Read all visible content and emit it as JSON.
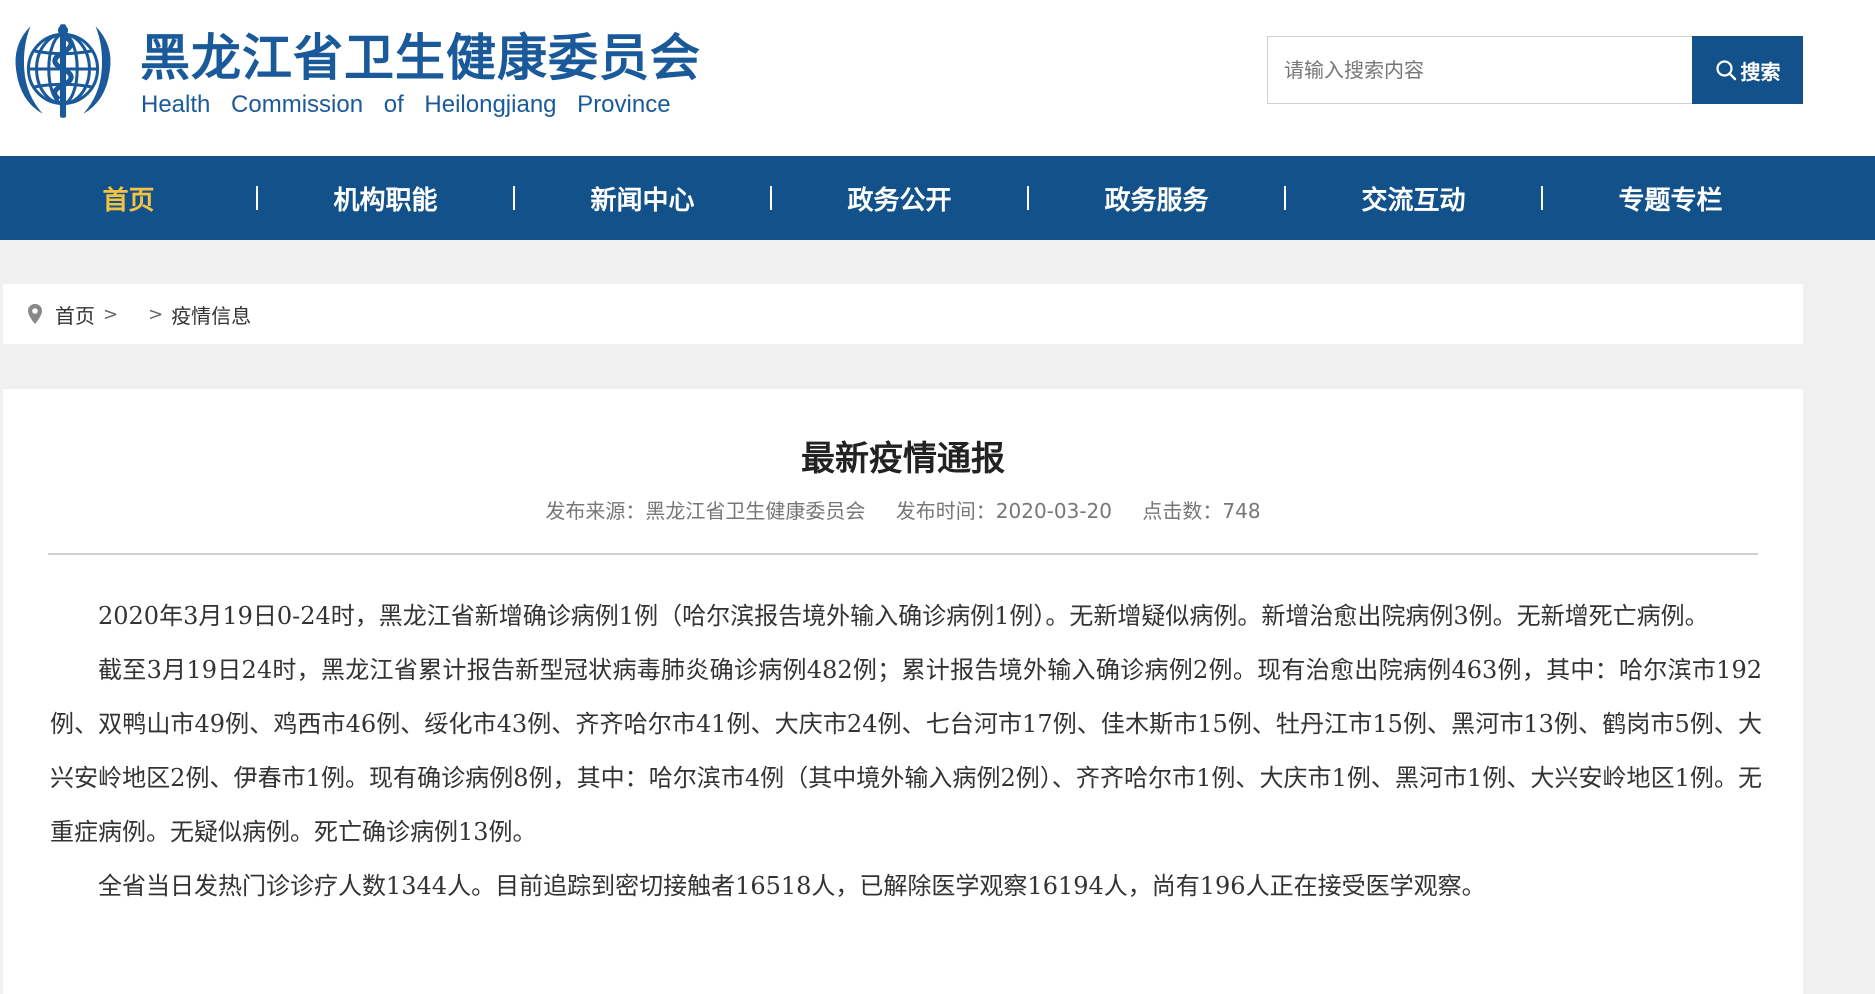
{
  "header": {
    "title_cn": "黑龙江省卫生健康委员会",
    "title_en": "Health Commission of Heilongjiang Province",
    "search_placeholder": "请输入搜索内容",
    "search_button": "搜索"
  },
  "nav": {
    "items": [
      {
        "label": "首页",
        "active": true
      },
      {
        "label": "机构职能"
      },
      {
        "label": "新闻中心"
      },
      {
        "label": "政务公开"
      },
      {
        "label": "政务服务"
      },
      {
        "label": "交流互动"
      },
      {
        "label": "专题专栏"
      }
    ]
  },
  "breadcrumb": {
    "home": "首页",
    "sep1": ">",
    "sep2": ">",
    "current": "疫情信息"
  },
  "article": {
    "title": "最新疫情通报",
    "meta": {
      "source": "发布来源：黑龙江省卫生健康委员会",
      "time": "发布时间：2020-03-20",
      "clicks": "点击数：748"
    },
    "paragraphs": [
      "2020年3月19日0-24时，黑龙江省新增确诊病例1例（哈尔滨报告境外输入确诊病例1例）。无新增疑似病例。新增治愈出院病例3例。无新增死亡病例。",
      "截至3月19日24时，黑龙江省累计报告新型冠状病毒肺炎确诊病例482例；累计报告境外输入确诊病例2例。现有治愈出院病例463例，其中：哈尔滨市192例、双鸭山市49例、鸡西市46例、绥化市43例、齐齐哈尔市41例、大庆市24例、七台河市17例、佳木斯市15例、牡丹江市15例、黑河市13例、鹤岗市5例、大兴安岭地区2例、伊春市1例。现有确诊病例8例，其中：哈尔滨市4例（其中境外输入病例2例）、齐齐哈尔市1例、大庆市1例、黑河市1例、大兴安岭地区1例。无重症病例。无疑似病例。死亡确诊病例13例。",
      "全省当日发热门诊诊疗人数1344人。目前追踪到密切接触者16518人，已解除医学观察16194人，尚有196人正在接受医学观察。"
    ]
  },
  "colors": {
    "brand": "#13518a",
    "title": "#1a5a9a",
    "nav_active": "#f5c242",
    "page_bg": "#f0f0f0"
  },
  "icons": {
    "logo": "who-emblem-icon",
    "search": "search-icon",
    "breadcrumb": "location-pin-icon"
  }
}
